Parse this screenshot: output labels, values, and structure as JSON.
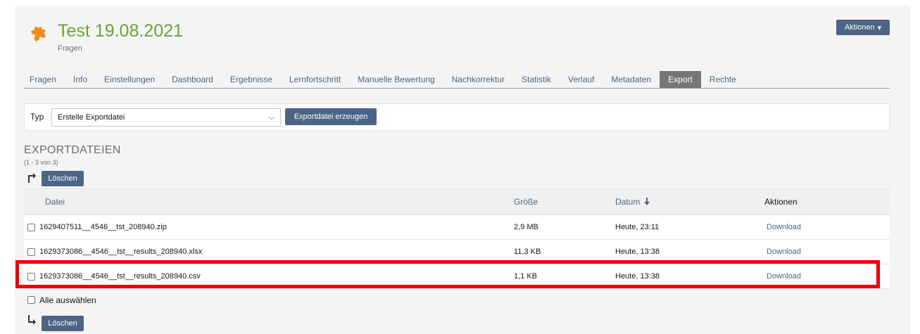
{
  "header": {
    "title": "Test 19.08.2021",
    "subtitle": "Fragen",
    "actions_label": "Aktionen",
    "icon": "puzzle-icon",
    "title_color": "#6ea03c"
  },
  "tabs": [
    {
      "label": "Fragen"
    },
    {
      "label": "Info"
    },
    {
      "label": "Einstellungen"
    },
    {
      "label": "Dashboard"
    },
    {
      "label": "Ergebnisse"
    },
    {
      "label": "Lernfortschritt"
    },
    {
      "label": "Manuelle Bewertung"
    },
    {
      "label": "Nachkorrektur"
    },
    {
      "label": "Statistik"
    },
    {
      "label": "Verlauf"
    },
    {
      "label": "Metadaten"
    },
    {
      "label": "Export",
      "active": true
    },
    {
      "label": "Rechte"
    }
  ],
  "toolbar": {
    "type_label": "Typ",
    "select_value": "Erstelle Exportdatei",
    "create_button": "Exportdatei erzeugen"
  },
  "section": {
    "title": "EXPORTDATEIEN",
    "count": "(1 - 3 von 3)",
    "delete_label": "Löschen"
  },
  "table": {
    "headers": {
      "file": "Datei",
      "size": "Größe",
      "date": "Datum",
      "actions": "Aktionen"
    },
    "rows": [
      {
        "file": "1629407511__4546__tst_208940.zip",
        "size": "2,9 MB",
        "date": "Heute, 23:11",
        "action": "Download"
      },
      {
        "file": "1629373086__4546__tst__results_208940.xlsx",
        "size": "11,3 KB",
        "date": "Heute, 13:38",
        "action": "Download"
      },
      {
        "file": "1629373086__4546__tst__results_208940.csv",
        "size": "1,1 KB",
        "date": "Heute, 13:38",
        "action": "Download"
      }
    ],
    "select_all": "Alle auswählen"
  },
  "colors": {
    "accent": "#4c6586",
    "highlight": "#e8000a"
  }
}
